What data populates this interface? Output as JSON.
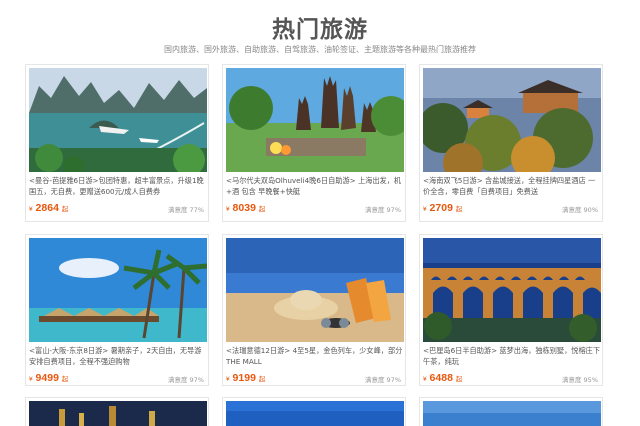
{
  "page": {
    "title": "热门旅游",
    "subtitle": "国内旅游、国外旅游、自助旅游、自驾旅游、油轮签证、主题旅游等各种最热门旅游推荐"
  },
  "cards": [
    {
      "desc": "<曼谷-芭提雅6日游>包团特惠，超丰富景点，升级1晚国五，无自费，更赠送600元/成人自费券",
      "currency": "¥",
      "price": "2864",
      "suffix": "起",
      "satisfaction": "满意度 77%"
    },
    {
      "desc": "<马尔代夫双岛Olhuveli4晚6日自助游> 上海出发，机+酒 包含 早晚餐+快艇",
      "currency": "¥",
      "price": "8039",
      "suffix": "起",
      "satisfaction": "满意度 97%"
    },
    {
      "desc": "<海南双飞5日游> 含盐城接送，全程挂牌四星酒店 一价全含，零自费「自费项目」免费送",
      "currency": "¥",
      "price": "2709",
      "suffix": "起",
      "satisfaction": "满意度 90%"
    },
    {
      "desc": "<富山-大阪-东京8日游> 暑期亲子，2天自由，无导游安排自费项目，全程不强迫购物",
      "currency": "¥",
      "price": "9499",
      "suffix": "起",
      "satisfaction": "满意度 97%"
    },
    {
      "desc": "<法瑞意德12日游> 4至5星，金色列车，少女峰，部分 THE MALL",
      "currency": "¥",
      "price": "9199",
      "suffix": "起",
      "satisfaction": "满意度 97%"
    },
    {
      "desc": "<巴厘岛6日半自助游> 蓝梦出海，独栋别墅，悦榕庄下午茶，纯玩",
      "currency": "¥",
      "price": "6488",
      "suffix": "起",
      "satisfaction": "满意度 95%"
    },
    {
      "desc": "",
      "currency": "",
      "price": "",
      "suffix": "",
      "satisfaction": ""
    },
    {
      "desc": "",
      "currency": "",
      "price": "",
      "suffix": "",
      "satisfaction": ""
    },
    {
      "desc": "",
      "currency": "",
      "price": "",
      "suffix": "",
      "satisfaction": ""
    }
  ],
  "icons": {
    "card0": "halong-bay-photo",
    "card1": "bali-temple-photo",
    "card2": "japanese-temple-photo",
    "card3": "palm-beach-huts-photo",
    "card4": "beach-hat-sandals-photo",
    "card5": "aqueduct-night-photo"
  }
}
